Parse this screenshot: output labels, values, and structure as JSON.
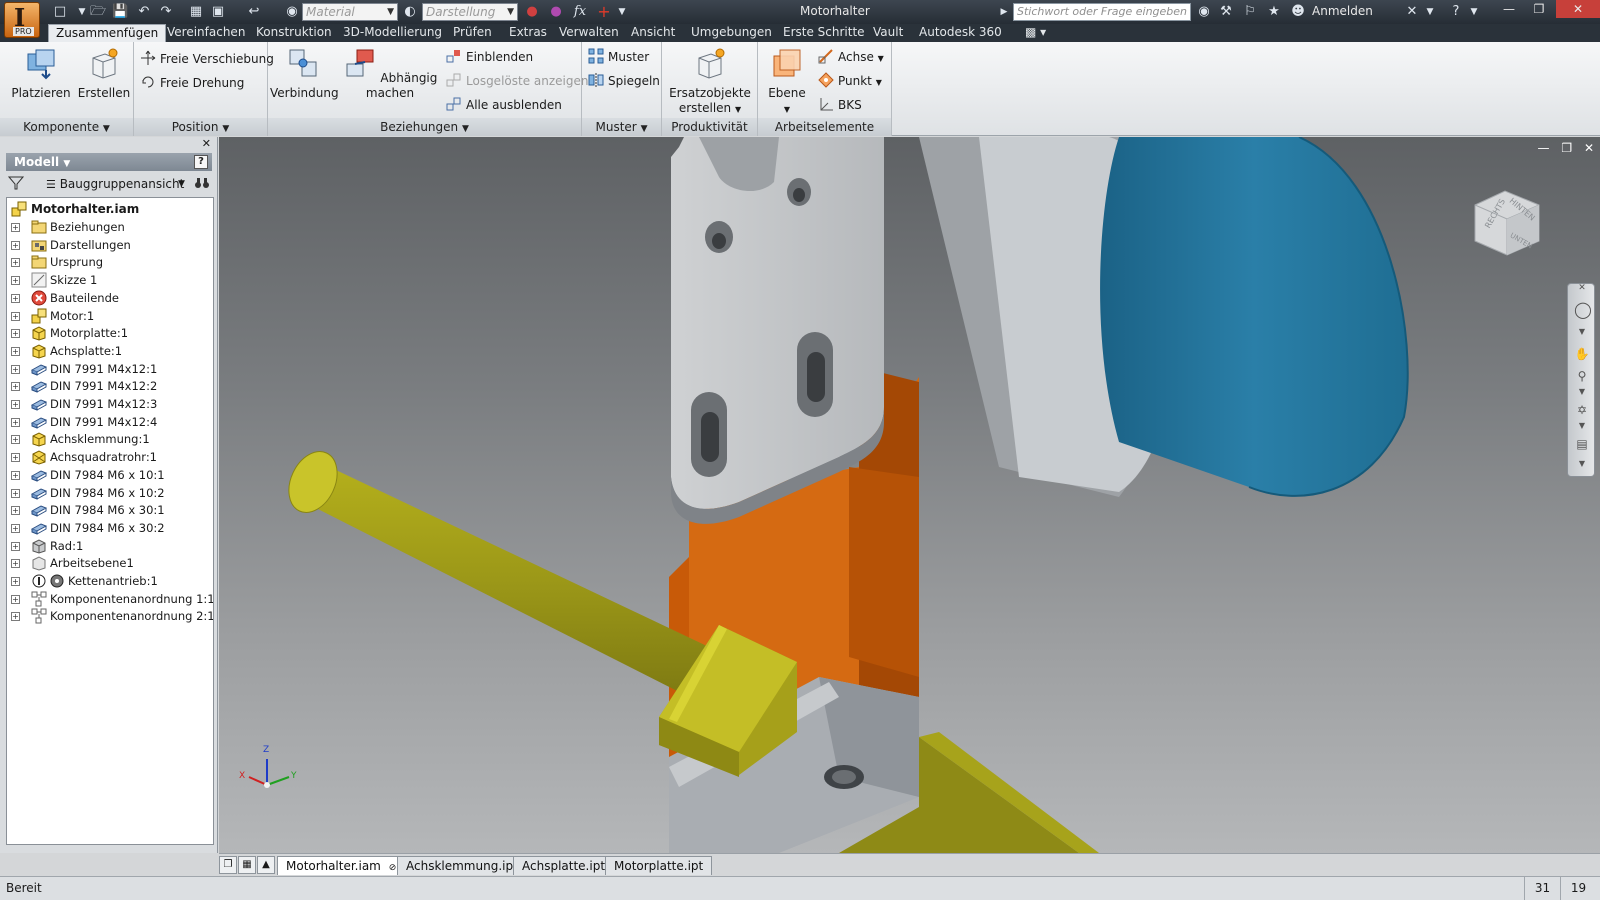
{
  "window": {
    "title": "Motorhalter",
    "app_letter": "I",
    "app_edition": "PRO"
  },
  "quick_access": {
    "material_placeholder": "Material",
    "display_placeholder": "Darstellung",
    "formula_glyph": "fx"
  },
  "help": {
    "search_placeholder": "Stichwort oder Frage eingeben",
    "signin_label": "Anmelden"
  },
  "tabs": [
    {
      "label": "Zusammenfügen",
      "active": true
    },
    {
      "label": "Vereinfachen"
    },
    {
      "label": "Konstruktion"
    },
    {
      "label": "3D-Modellierung"
    },
    {
      "label": "Prüfen"
    },
    {
      "label": "Extras"
    },
    {
      "label": "Verwalten"
    },
    {
      "label": "Ansicht"
    },
    {
      "label": "Umgebungen"
    },
    {
      "label": "Erste Schritte"
    },
    {
      "label": "Vault"
    },
    {
      "label": "Autodesk 360"
    }
  ],
  "ribbon": {
    "komponente": {
      "footer": "Komponente",
      "place": "Platzieren",
      "create": "Erstellen"
    },
    "position": {
      "footer": "Position",
      "free_move": "Freie Verschiebung",
      "free_rotate": "Freie Drehung"
    },
    "beziehungen": {
      "footer": "Beziehungen",
      "joint": "Verbindung",
      "constrain": "Abhängig machen",
      "show": "Einblenden",
      "show_relaxed": "Losgelöste anzeigen",
      "hide_all": "Alle ausblenden"
    },
    "muster": {
      "footer": "Muster",
      "pattern": "Muster",
      "mirror": "Spiegeln"
    },
    "produktivitaet": {
      "footer": "Produktivität",
      "substitute_line1": "Ersatzobjekte",
      "substitute_line2": "erstellen"
    },
    "arbeitselemente": {
      "footer": "Arbeitselemente",
      "plane": "Ebene",
      "axis": "Achse",
      "point": "Punkt",
      "ucs": "BKS"
    }
  },
  "browser": {
    "title": "Modell",
    "help_glyph": "?",
    "view": "Bauggruppenansicht",
    "root": "Motorhalter.iam",
    "items": [
      {
        "label": "Beziehungen",
        "icon": "folder-icon"
      },
      {
        "label": "Darstellungen",
        "icon": "representations-icon"
      },
      {
        "label": "Ursprung",
        "icon": "folder-icon"
      },
      {
        "label": "Skizze 1",
        "icon": "sketch-icon"
      },
      {
        "label": "Bauteilende",
        "icon": "end-of-part-icon"
      },
      {
        "label": "Motor:1",
        "icon": "subassembly-icon"
      },
      {
        "label": "Motorplatte:1",
        "icon": "part-icon"
      },
      {
        "label": "Achsplatte:1",
        "icon": "part-icon"
      },
      {
        "label": "DIN 7991 M4x12:1",
        "icon": "content-center-icon"
      },
      {
        "label": "DIN 7991 M4x12:2",
        "icon": "content-center-icon"
      },
      {
        "label": "DIN 7991 M4x12:3",
        "icon": "content-center-icon"
      },
      {
        "label": "DIN 7991 M4x12:4",
        "icon": "content-center-icon"
      },
      {
        "label": "Achsklemmung:1",
        "icon": "part-icon"
      },
      {
        "label": "Achsquadratrohr:1",
        "icon": "frame-part-icon"
      },
      {
        "label": "DIN 7984 M6 x 10:1",
        "icon": "content-center-icon"
      },
      {
        "label": "DIN 7984 M6 x 10:2",
        "icon": "content-center-icon"
      },
      {
        "label": "DIN 7984 M6 x 30:1",
        "icon": "content-center-icon"
      },
      {
        "label": "DIN 7984 M6 x 30:2",
        "icon": "content-center-icon"
      },
      {
        "label": "Rad:1",
        "icon": "grey-part-icon"
      },
      {
        "label": "Arbeitsebene1",
        "icon": "work-plane-icon"
      },
      {
        "label": "Kettenantrieb:1",
        "icon": "chain-drive-icon"
      },
      {
        "label": "Komponentenanordnung 1:1",
        "icon": "pattern-icon"
      },
      {
        "label": "Komponentenanordnung 2:1",
        "icon": "pattern-icon"
      }
    ]
  },
  "viewcube": {
    "right": "RECHTS",
    "back": "HINTEN",
    "bottom": "UNTEN"
  },
  "triad": {
    "x": "X",
    "y": "Y",
    "z": "Z"
  },
  "document_tabs": [
    {
      "label": "Motorhalter.iam",
      "active": true
    },
    {
      "label": "Achsklemmung.ipt"
    },
    {
      "label": "Achsplatte.ipt"
    },
    {
      "label": "Motorplatte.ipt"
    }
  ],
  "status": {
    "text": "Bereit",
    "count1": "31",
    "count2": "19"
  },
  "colors": {
    "motor_blue": "#1f6e93",
    "orange_part": "#c85a08",
    "yellow_part": "#b8b41d",
    "grey_plate": "#c6c8ca",
    "title_bar": "#2d343c",
    "ribbon": "#eceef0"
  }
}
